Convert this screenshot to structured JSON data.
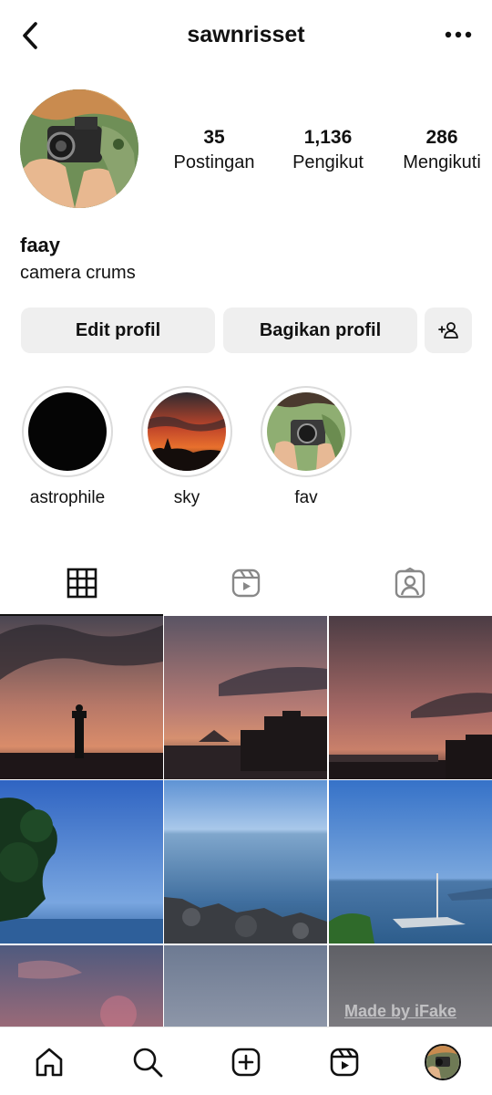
{
  "header": {
    "username": "sawnrisset",
    "back_icon": "chevron-left-icon",
    "more_icon": "more-horizontal-icon"
  },
  "profile": {
    "name": "faay",
    "bio": "camera crums",
    "stats": [
      {
        "value": "35",
        "label": "Postingan"
      },
      {
        "value": "1,136",
        "label": "Pengikut"
      },
      {
        "value": "286",
        "label": "Mengikuti"
      }
    ]
  },
  "buttons": {
    "edit": "Edit profil",
    "share": "Bagikan profil",
    "add_person_icon": "add-person-icon"
  },
  "highlights": [
    {
      "label": "astrophile"
    },
    {
      "label": "sky"
    },
    {
      "label": "fav"
    }
  ],
  "tabs": [
    {
      "icon": "grid-icon",
      "active": true
    },
    {
      "icon": "reels-icon",
      "active": false
    },
    {
      "icon": "tagged-icon",
      "active": false
    }
  ],
  "watermark": "Made by iFake",
  "bottom_nav": [
    {
      "icon": "home-icon"
    },
    {
      "icon": "search-icon"
    },
    {
      "icon": "create-icon"
    },
    {
      "icon": "reels-icon"
    },
    {
      "icon": "profile-avatar"
    }
  ],
  "colors": {
    "button_bg": "#efefef",
    "text": "#111111",
    "ring": "#dbdbdb"
  }
}
